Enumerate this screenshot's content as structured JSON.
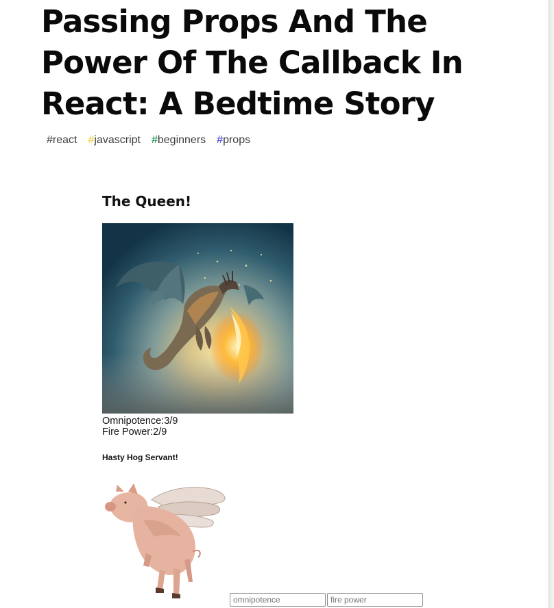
{
  "article": {
    "title": "Passing Props And The Power Of The Callback In React: A Bedtime Story",
    "tags": [
      {
        "hash": "#",
        "label": "react",
        "hash_color": "#3d3d3d"
      },
      {
        "hash": "#",
        "label": "javascript",
        "hash_color": "#f7df1e"
      },
      {
        "hash": "#",
        "label": "beginners",
        "hash_color": "#008335"
      },
      {
        "hash": "#",
        "label": "props",
        "hash_color": "#2a2ad6"
      }
    ]
  },
  "embed": {
    "heading": "The Queen!",
    "dragon_icon": "dragon-breathing-fire-image",
    "stats": {
      "omnipotence_label": "Omnipotence:",
      "omnipotence_value": "3/9",
      "fire_power_label": "Fire Power:",
      "fire_power_value": "2/9"
    },
    "servant_heading": "Hasty Hog Servant!",
    "pig_icon": "flying-pig-image",
    "inputs": {
      "omnipotence_placeholder": "omnipotence",
      "fire_power_placeholder": "fire power"
    }
  }
}
